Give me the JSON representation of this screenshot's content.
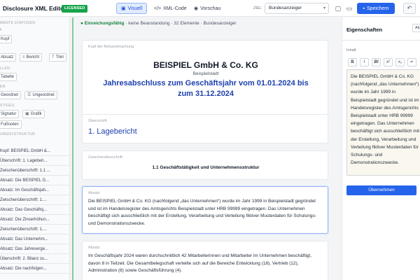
{
  "header": {
    "app_title": "Disclosure XML Editor",
    "license_badge": "LICENSED",
    "modes": [
      {
        "label": "Visuell",
        "icon": "layout-icon"
      },
      {
        "label": "XML-Code",
        "icon": "code-icon"
      },
      {
        "label": "Vorschau",
        "icon": "eye-icon"
      }
    ],
    "active_mode": "Visuell",
    "ziel_label": "ZIEL",
    "ziel_value": "Bundesanzeiger",
    "save_label": "Speichern"
  },
  "sidebar": {
    "insert_label": "MENTE EINFÜGEN",
    "insert_sub": "F",
    "kopf": "Kopf",
    "absatz": "Absatz",
    "bericht": "Bericht",
    "titel": "Titel",
    "tables_label": "LLEN",
    "tabelle": "Tabelle",
    "lists_label": "EN",
    "geordnet": "Geordnet",
    "ungeordnet": "Ungeordnet",
    "other_label": "STIGES",
    "signatur": "Signatur",
    "grafik": "Grafik",
    "fussnoten": "Fußnoten",
    "structure_label": "UMENTSTRUKTUR",
    "structure_items": [
      "Kopf: BEISPIEL GmbH &...",
      "Überschrift: 1. Lageberi...",
      "Zwischenüberschrift: 1.1 ...",
      "Absatz: Die BEISPIEL G...",
      "Absatz: Im Geschäftsjah...",
      "Zwischenüberschrift: 1....",
      "Absatz: Das Geschäftsj...",
      "Absatz: Die Zinserhöhun...",
      "Zwischenüberschrift: 1....",
      "Absatz: Das Unternehm...",
      "Absatz: Das Jahresergе...",
      "Überschrift: 2. Bilanz zu...",
      "Absatz: Die nachfolgen..."
    ]
  },
  "main": {
    "status_ok": "Einreichungsfähig",
    "status_rest": " · keine Beanstandung · 32 Elemente · Bundesanzeiger",
    "header_card": {
      "label": "Kopf der Bekanntmachung",
      "company": "BEISPIEL GmbH & Co. KG",
      "city": "Beispielstadt",
      "title": "Jahresabschluss zum Geschäftsjahr vom 01.01.2024 bis zum 31.12.2024"
    },
    "heading_card": {
      "label": "Überschrift",
      "text": "1. Lagebericht"
    },
    "subheading_card": {
      "label": "Zwischenüberschrift",
      "text": "1.1 Geschäftstätigkeit und Unternehmensstruktur"
    },
    "para1": {
      "label": "Absatz",
      "text": "Die BEISPIEL GmbH & Co. KG (nachfolgend „das Unternehmen“) wurde im Jahr 1999 in Beispielstadt gegründet und ist im Handelsregister des Amtsgerichts Beispielstadt unter HRB 99999 eingetragen. Das Unternehmen beschäftigt sich ausschließlich mit der Erstellung, Verarbeitung und Verteilung fiktiver Musterdaten für Schulungs- und Demonstrationszwecke."
    },
    "para2": {
      "label": "Absatz",
      "text": "Im Geschäftsjahr 2024 waren durchschnittlich 42 Mitarbeiterinnen und Mitarbeiter im Unternehmen beschäftigt, davon 8 in Teilzeit. Die Gesamtbelegschaft verteilte sich auf die Bereiche Entwicklung (18), Vertrieb (12), Administration (8) sowie Geschäftsführung (4)."
    }
  },
  "properties": {
    "title": "Eigenschaften",
    "tab": "Absa",
    "content_label": "Inhalt",
    "format_buttons": [
      "B",
      "I",
      "BI",
      "x²",
      "x₂",
      "↵"
    ],
    "text": "Die BEISPIEL GmbH & Co. KG (nachfolgend „das Unternehmen“) wurde im Jahr 1999 in Beispielstadt gegründet und ist im Handelsregister des Amtsgerichts Beispielstadt unter HRB 99999 eingetragen. Das Unternehmen beschäftigt sich ausschließlich mit der Erstellung, Verarbeitung und Verteilung fiktiver Musterdaten für Schulungs- und Demonstrationszwecke.",
    "apply_label": "Übernehmen"
  }
}
